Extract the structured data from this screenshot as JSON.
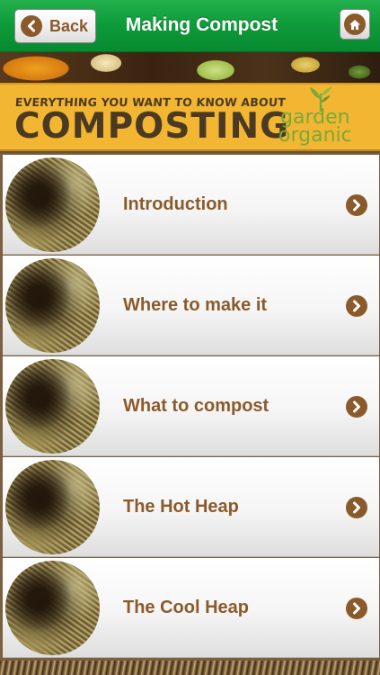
{
  "nav": {
    "back_label": "Back",
    "title": "Making Compost",
    "back_icon": "chevron-left-icon",
    "home_icon": "home-icon"
  },
  "banner": {
    "tagline": "EVERYTHING YOU WANT TO KNOW ABOUT",
    "title": "COMPOSTING",
    "brand_line1": "garden",
    "brand_line2": "organic"
  },
  "list": {
    "items": [
      {
        "label": "Introduction"
      },
      {
        "label": "Where to make it"
      },
      {
        "label": "What to compost"
      },
      {
        "label": "The Hot Heap"
      },
      {
        "label": "The Cool Heap"
      }
    ]
  },
  "colors": {
    "nav_green": "#0e9a3a",
    "accent_brown": "#8b5a2b",
    "banner_yellow": "#f2b632",
    "banner_text": "#4b3a22",
    "brand_green": "#7aa83a"
  }
}
